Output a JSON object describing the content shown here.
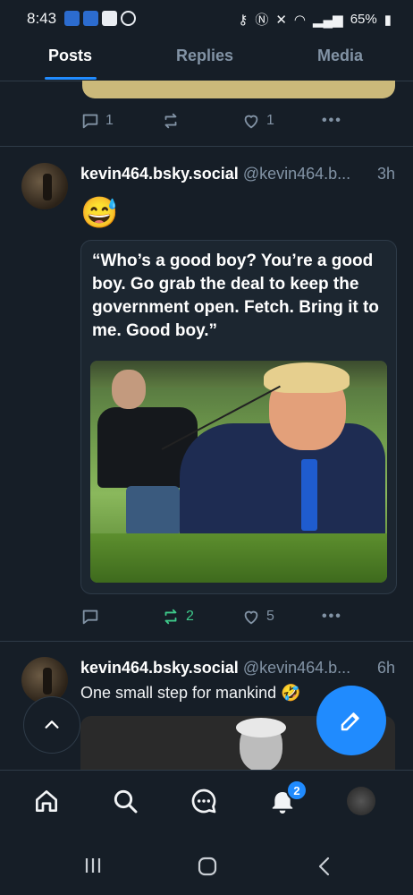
{
  "status_bar": {
    "time": "8:43",
    "battery": "65%"
  },
  "tabs": [
    {
      "label": "Posts",
      "active": true
    },
    {
      "label": "Replies",
      "active": false
    },
    {
      "label": "Media",
      "active": false
    }
  ],
  "prev_post": {
    "reply_count": "1",
    "like_count": "1"
  },
  "post1": {
    "display_name": "kevin464.bsky.social",
    "handle": "@kevin464.b...",
    "time_ago": "3h",
    "emoji": "😅",
    "quote_text": "“Who’s a good boy? You’re a good boy. Go grab the deal to keep the government open. Fetch. Bring it to me. Good boy.”",
    "repost_count": "2",
    "like_count": "5",
    "repost_color": "#3ec98a"
  },
  "post2": {
    "display_name": "kevin464.bsky.social",
    "handle": "@kevin464.b...",
    "time_ago": "6h",
    "text": "One small step for mankind 🤣"
  },
  "notifications_badge": "2",
  "accent_color": "#208bfe",
  "icons": [
    "home-icon",
    "search-icon",
    "chat-icon",
    "bell-icon",
    "avatar",
    "compose-icon",
    "chevron-up-icon"
  ]
}
